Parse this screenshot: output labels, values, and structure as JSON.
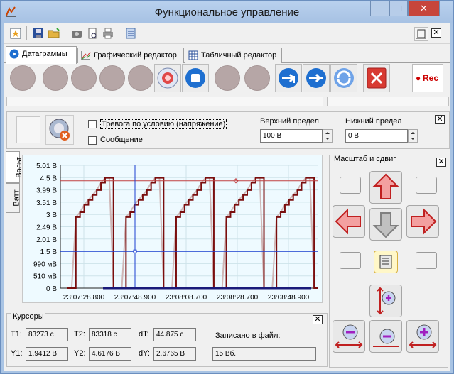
{
  "window": {
    "title": "Функциональное управление",
    "minimize": "—",
    "maximize": "□",
    "close": "✕"
  },
  "toolbar": {
    "icons": [
      "star-doc-icon",
      "save-icon",
      "open-folder-icon",
      "camera-icon",
      "preview-icon",
      "print-icon",
      "settings-icon"
    ]
  },
  "tabs": [
    {
      "label": "Датаграммы",
      "active": true
    },
    {
      "label": "Графический редактор",
      "active": false
    },
    {
      "label": "Табличный редактор",
      "active": false
    }
  ],
  "controls": {
    "rec_label": "Rec"
  },
  "alarm": {
    "cb1": "Тревога по условию (напряжение)",
    "cb2": "Сообщение",
    "upper_label": "Верхний предел",
    "upper_value": "100 В",
    "lower_label": "Нижний предел",
    "lower_value": "0 В"
  },
  "side_tabs": [
    "Вольт",
    "Ватт"
  ],
  "scale": {
    "title": "Масштаб и сдвиг"
  },
  "chart_data": {
    "type": "line",
    "y_ticks": [
      "5.01 В",
      "4.5 В",
      "3.99 В",
      "3.51 В",
      "3 В",
      "2.49 В",
      "2.01 В",
      "1.5 В",
      "990 мВ",
      "510 мВ",
      "0 В"
    ],
    "x_ticks": [
      "23:07:28.800",
      "23:07:48.900",
      "23:08:08.700",
      "23:08:28.700",
      "23:08:48.900",
      "23:"
    ],
    "ylim": [
      0,
      5.01
    ],
    "cursor": {
      "x": "23:07:48.900",
      "y": 1.5
    },
    "threshold_y": 4.38,
    "series": [
      {
        "values": [
          0,
          0,
          2.9,
          3.1,
          3.4,
          3.6,
          3.8,
          4.0,
          4.3,
          4.5,
          4.5,
          0,
          0,
          0,
          2.9,
          3.1,
          3.4,
          3.6,
          3.8,
          4.0,
          4.3,
          4.5,
          4.5,
          0,
          0,
          0,
          2.9,
          3.1,
          3.4,
          3.6,
          3.8,
          4.0,
          4.3,
          4.5,
          4.5,
          0,
          0,
          0,
          2.9,
          3.1,
          3.4,
          3.6,
          3.8,
          4.0,
          4.3,
          4.5,
          4.5,
          0,
          0,
          0,
          2.9,
          3.1,
          3.4,
          3.6,
          3.8,
          4.0,
          4.3,
          4.5,
          4.5,
          0,
          0
        ]
      }
    ]
  },
  "cursors": {
    "title": "Курсоры",
    "t1_label": "T1:",
    "t1": "83273 с",
    "t2_label": "T2:",
    "t2": "83318 с",
    "dt_label": "dT:",
    "dt": "44.875 с",
    "y1_label": "Y1:",
    "y1": "1.9412 В",
    "y2_label": "Y2:",
    "y2": "4.6176 В",
    "dy_label": "dY:",
    "dy": "2.6765 В",
    "file_label": "Записано в файл:",
    "file": "15 Вб."
  }
}
